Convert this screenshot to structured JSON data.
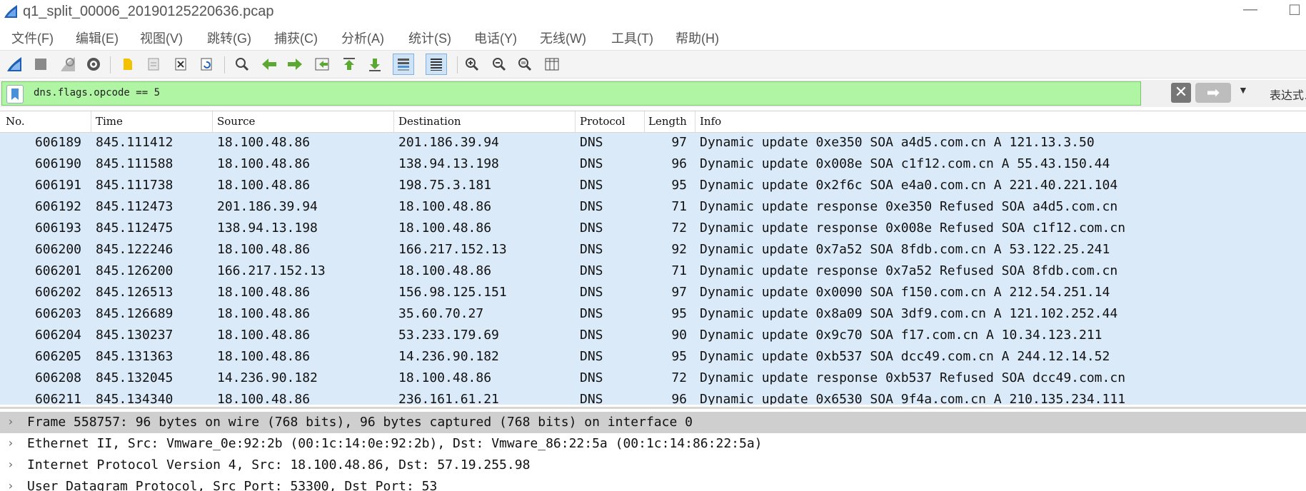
{
  "window": {
    "title": "q1_split_00006_20190125220636.pcap",
    "minimize_glyph": "—",
    "maximize_glyph": "☐"
  },
  "menu": [
    "文件(F)",
    "编辑(E)",
    "视图(V)",
    "跳转(G)",
    "捕获(C)",
    "分析(A)",
    "统计(S)",
    "电话(Y)",
    "无线(W)",
    "工具(T)",
    "帮助(H)"
  ],
  "toolbar": {
    "icons": [
      "start-capture-icon",
      "stop-capture-icon",
      "restart-capture-icon",
      "capture-options-icon",
      "open-file-icon",
      "save-file-icon",
      "close-file-icon",
      "reload-file-icon",
      "find-packet-icon",
      "go-back-icon",
      "go-forward-icon",
      "go-to-packet-icon",
      "go-first-icon",
      "go-last-icon",
      "auto-scroll-icon",
      "colorize-icon",
      "zoom-in-icon",
      "zoom-out-icon",
      "zoom-normal-icon",
      "resize-columns-icon"
    ]
  },
  "filter": {
    "value": "dns.flags.opcode == 5",
    "clear_glyph": "✕",
    "apply_glyph": "➡",
    "dropdown_glyph": "▼",
    "expression_label": "表达式…"
  },
  "columns": [
    "No.",
    "Time",
    "Source",
    "Destination",
    "Protocol",
    "Length",
    "Info"
  ],
  "packets": [
    {
      "no": "606189",
      "time": "845.111412",
      "src": "18.100.48.86",
      "dst": "201.186.39.94",
      "proto": "DNS",
      "len": "97",
      "info": "Dynamic update 0xe350 SOA a4d5.com.cn A 121.13.3.50"
    },
    {
      "no": "606190",
      "time": "845.111588",
      "src": "18.100.48.86",
      "dst": "138.94.13.198",
      "proto": "DNS",
      "len": "96",
      "info": "Dynamic update 0x008e SOA c1f12.com.cn A 55.43.150.44"
    },
    {
      "no": "606191",
      "time": "845.111738",
      "src": "18.100.48.86",
      "dst": "198.75.3.181",
      "proto": "DNS",
      "len": "95",
      "info": "Dynamic update 0x2f6c SOA e4a0.com.cn A 221.40.221.104"
    },
    {
      "no": "606192",
      "time": "845.112473",
      "src": "201.186.39.94",
      "dst": "18.100.48.86",
      "proto": "DNS",
      "len": "71",
      "info": "Dynamic update response 0xe350 Refused SOA a4d5.com.cn"
    },
    {
      "no": "606193",
      "time": "845.112475",
      "src": "138.94.13.198",
      "dst": "18.100.48.86",
      "proto": "DNS",
      "len": "72",
      "info": "Dynamic update response 0x008e Refused SOA c1f12.com.cn"
    },
    {
      "no": "606200",
      "time": "845.122246",
      "src": "18.100.48.86",
      "dst": "166.217.152.13",
      "proto": "DNS",
      "len": "92",
      "info": "Dynamic update 0x7a52 SOA 8fdb.com.cn A 53.122.25.241"
    },
    {
      "no": "606201",
      "time": "845.126200",
      "src": "166.217.152.13",
      "dst": "18.100.48.86",
      "proto": "DNS",
      "len": "71",
      "info": "Dynamic update response 0x7a52 Refused SOA 8fdb.com.cn"
    },
    {
      "no": "606202",
      "time": "845.126513",
      "src": "18.100.48.86",
      "dst": "156.98.125.151",
      "proto": "DNS",
      "len": "97",
      "info": "Dynamic update 0x0090 SOA f150.com.cn A 212.54.251.14"
    },
    {
      "no": "606203",
      "time": "845.126689",
      "src": "18.100.48.86",
      "dst": "35.60.70.27",
      "proto": "DNS",
      "len": "95",
      "info": "Dynamic update 0x8a09 SOA 3df9.com.cn A 121.102.252.44"
    },
    {
      "no": "606204",
      "time": "845.130237",
      "src": "18.100.48.86",
      "dst": "53.233.179.69",
      "proto": "DNS",
      "len": "90",
      "info": "Dynamic update 0x9c70 SOA f17.com.cn A 10.34.123.211"
    },
    {
      "no": "606205",
      "time": "845.131363",
      "src": "18.100.48.86",
      "dst": "14.236.90.182",
      "proto": "DNS",
      "len": "95",
      "info": "Dynamic update 0xb537 SOA dcc49.com.cn A 244.12.14.52"
    },
    {
      "no": "606208",
      "time": "845.132045",
      "src": "14.236.90.182",
      "dst": "18.100.48.86",
      "proto": "DNS",
      "len": "72",
      "info": "Dynamic update response 0xb537 Refused SOA dcc49.com.cn"
    },
    {
      "no": "606211",
      "time": "845.134340",
      "src": "18.100.48.86",
      "dst": "236.161.61.21",
      "proto": "DNS",
      "len": "96",
      "info": "Dynamic update 0x6530 SOA 9f4a.com.cn A 210.135.234.111"
    }
  ],
  "details": [
    {
      "text": "Frame 558757: 96 bytes on wire (768 bits), 96 bytes captured (768 bits) on interface 0",
      "selected": true
    },
    {
      "text": "Ethernet II, Src: Vmware_0e:92:2b (00:1c:14:0e:92:2b), Dst: Vmware_86:22:5a (00:1c:14:86:22:5a)",
      "selected": false
    },
    {
      "text": "Internet Protocol Version 4, Src: 18.100.48.86, Dst: 57.19.255.98",
      "selected": false
    },
    {
      "text": "User Datagram Protocol, Src Port: 53300, Dst Port: 53",
      "selected": false
    }
  ],
  "expand_glyph": "›"
}
